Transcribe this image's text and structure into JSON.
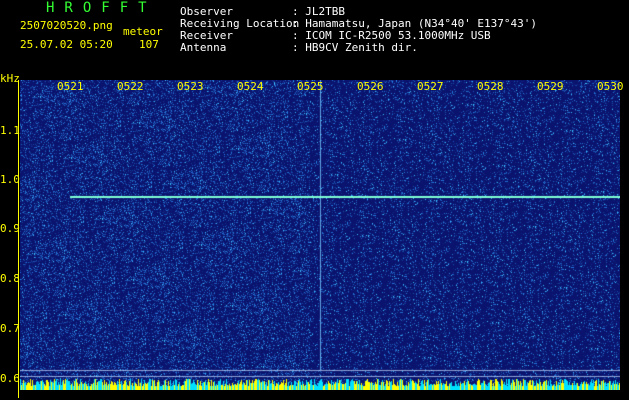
{
  "header": {
    "brand": "HROFFT",
    "filename": "2507020520.png",
    "timestamp": "25.07.02 05:20",
    "meteor_label": "meteor",
    "meteor_count": "107",
    "fields": [
      {
        "label": "Observer",
        "value": ": JL2TBB"
      },
      {
        "label": "Receiving Location",
        "value": ": Hamamatsu, Japan (N34°40' E137°43')"
      },
      {
        "label": "Receiver",
        "value": ": ICOM IC-R2500 53.1000MHz USB"
      },
      {
        "label": "Antenna",
        "value": ": HB9CV Zenith dir."
      }
    ]
  },
  "axes": {
    "y_unit": "kHz",
    "y_ticks": [
      "1.1",
      "1.0",
      "0.9",
      "0.8",
      "0.7",
      "0.6"
    ],
    "x_ticks": [
      "0521",
      "0522",
      "0523",
      "0524",
      "0525",
      "0526",
      "0527",
      "0528",
      "0529",
      "0530"
    ]
  },
  "colors": {
    "background": "#000000",
    "text": "#ffffff",
    "axis": "#ffff00",
    "brand": "#33ff33",
    "spectrum_low": "#0a1a80",
    "spectrum_high": "#60c0ff",
    "carrier": "#7fffd4"
  }
}
